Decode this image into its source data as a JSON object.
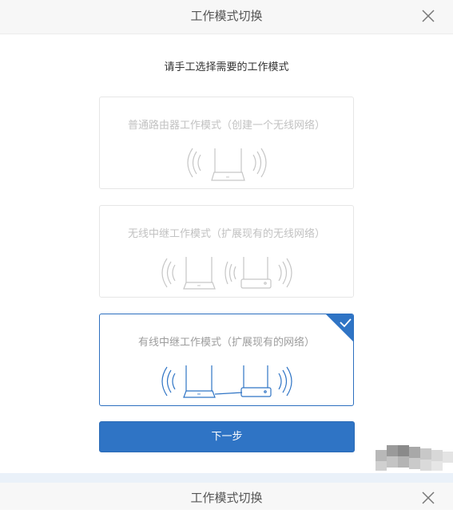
{
  "dialog": {
    "title": "工作模式切换"
  },
  "subtitle": "请手工选择需要的工作模式",
  "modes": [
    {
      "label": "普通路由器工作模式（创建一个无线网络）",
      "selected": false
    },
    {
      "label": "无线中继工作模式（扩展现有的无线网络）",
      "selected": false
    },
    {
      "label": "有线中继工作模式（扩展现有的网络）",
      "selected": true
    }
  ],
  "router_badge": "mi",
  "next_button": "下一步",
  "dialog2": {
    "title": "工作模式切换"
  },
  "colors": {
    "accent": "#2f74c5",
    "selected_border": "#2c6fbf"
  },
  "icons": {
    "close": "close-icon",
    "check": "check-icon"
  }
}
